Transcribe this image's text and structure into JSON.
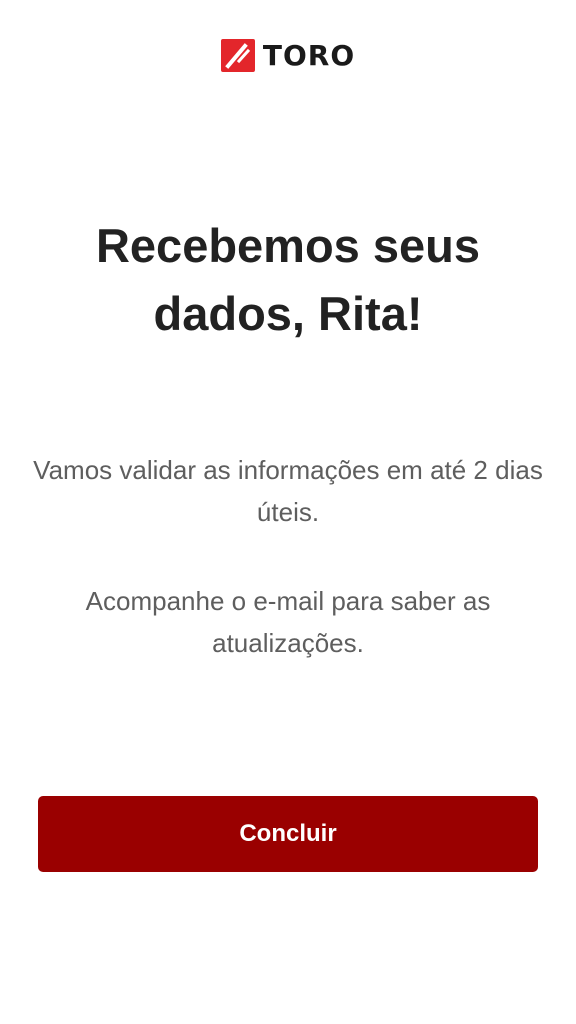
{
  "brand": {
    "name": "TORO",
    "logo_icon": "toro-logo-icon",
    "logo_color": "#e3262b"
  },
  "confirmation": {
    "title": "Recebemos seus dados, Rita!",
    "message_validation": "Vamos validar as informações em até 2 dias úteis.",
    "message_email": "Acompanhe o e-mail para saber as atualizações."
  },
  "actions": {
    "conclude_label": "Concluir",
    "button_color": "#9a0000"
  }
}
